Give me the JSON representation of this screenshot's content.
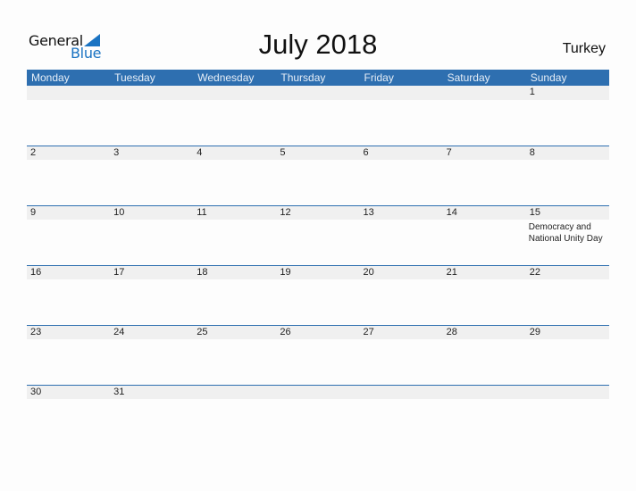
{
  "logo": {
    "general": "General",
    "blue": "Blue"
  },
  "title": "July 2018",
  "country": "Turkey",
  "weekdays": [
    "Monday",
    "Tuesday",
    "Wednesday",
    "Thursday",
    "Friday",
    "Saturday",
    "Sunday"
  ],
  "weeks": [
    {
      "days": [
        "",
        "",
        "",
        "",
        "",
        "",
        "1"
      ],
      "events": [
        "",
        "",
        "",
        "",
        "",
        "",
        ""
      ]
    },
    {
      "days": [
        "2",
        "3",
        "4",
        "5",
        "6",
        "7",
        "8"
      ],
      "events": [
        "",
        "",
        "",
        "",
        "",
        "",
        ""
      ]
    },
    {
      "days": [
        "9",
        "10",
        "11",
        "12",
        "13",
        "14",
        "15"
      ],
      "events": [
        "",
        "",
        "",
        "",
        "",
        "",
        "Democracy and National Unity Day"
      ]
    },
    {
      "days": [
        "16",
        "17",
        "18",
        "19",
        "20",
        "21",
        "22"
      ],
      "events": [
        "",
        "",
        "",
        "",
        "",
        "",
        ""
      ]
    },
    {
      "days": [
        "23",
        "24",
        "25",
        "26",
        "27",
        "28",
        "29"
      ],
      "events": [
        "",
        "",
        "",
        "",
        "",
        "",
        ""
      ]
    },
    {
      "days": [
        "30",
        "31",
        "",
        "",
        "",
        "",
        ""
      ],
      "events": [
        "",
        "",
        "",
        "",
        "",
        "",
        ""
      ]
    }
  ],
  "colors": {
    "accent": "#2e6fb0",
    "logo_blue": "#1a73c2",
    "row_bg": "#f0f0f0"
  }
}
